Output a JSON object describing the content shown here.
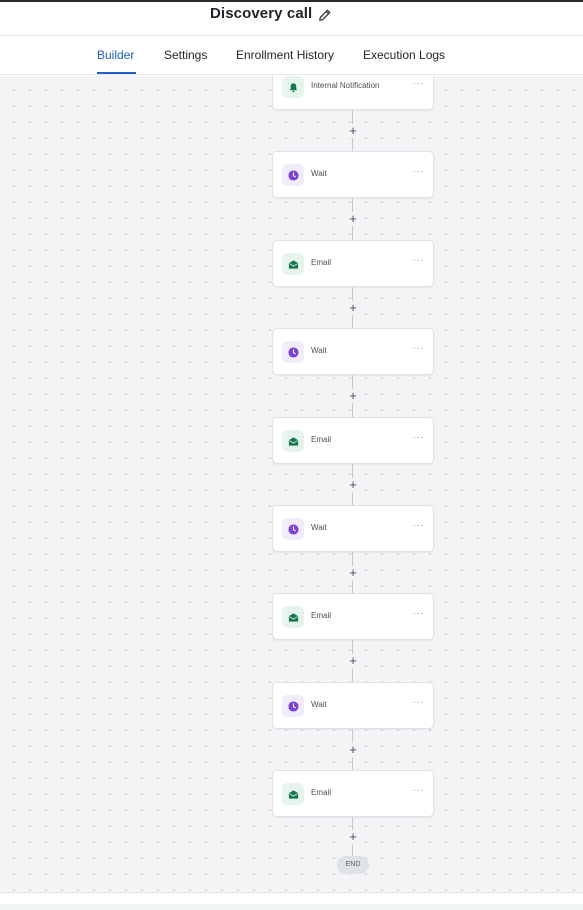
{
  "header": {
    "title": "Discovery call",
    "edit_icon": "pencil-icon"
  },
  "tabs": [
    {
      "label": "Builder",
      "active": true
    },
    {
      "label": "Settings",
      "active": false
    },
    {
      "label": "Enrollment History",
      "active": false
    },
    {
      "label": "Execution Logs",
      "active": false
    }
  ],
  "colors": {
    "accent": "#1d5fd1",
    "wait_icon": "#7b3fe4",
    "email_icon": "#12794f"
  },
  "workflow": {
    "nodes": [
      {
        "label": "Internal Notification",
        "icon": "bell-icon"
      },
      {
        "label": "Wait",
        "icon": "clock-icon"
      },
      {
        "label": "Email",
        "icon": "mail-icon"
      },
      {
        "label": "Wait",
        "icon": "clock-icon"
      },
      {
        "label": "Email",
        "icon": "mail-icon"
      },
      {
        "label": "Wait",
        "icon": "clock-icon"
      },
      {
        "label": "Email",
        "icon": "mail-icon"
      },
      {
        "label": "Wait",
        "icon": "clock-icon"
      },
      {
        "label": "Email",
        "icon": "mail-icon"
      }
    ],
    "add_step_symbol": "+",
    "node_menu_symbol": "···",
    "end_label": "END"
  }
}
